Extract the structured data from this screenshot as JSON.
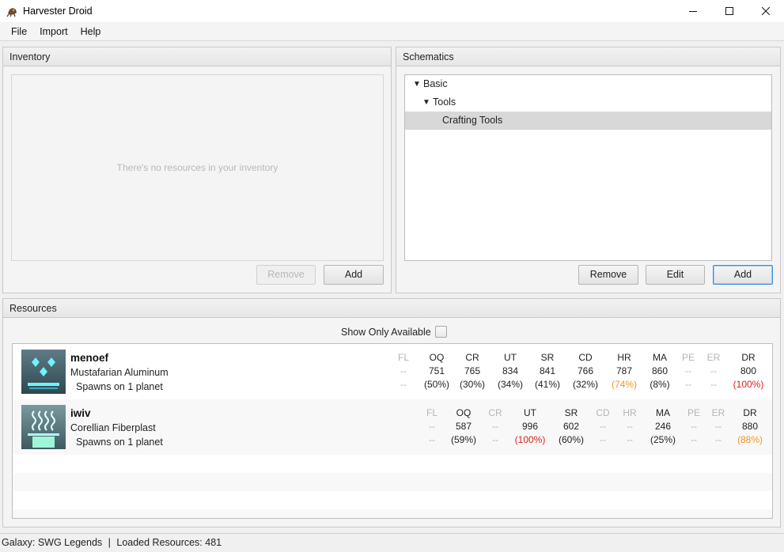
{
  "window": {
    "title": "Harvester Droid"
  },
  "menu": [
    "File",
    "Import",
    "Help"
  ],
  "inventory": {
    "title": "Inventory",
    "placeholder": "There's no resources in your inventory",
    "remove_label": "Remove",
    "add_label": "Add"
  },
  "schematics": {
    "title": "Schematics",
    "tree": [
      {
        "label": "Basic",
        "expanded": true,
        "level": 0
      },
      {
        "label": "Tools",
        "expanded": true,
        "level": 1
      },
      {
        "label": "Crafting Tools",
        "selected": true,
        "level": 2
      }
    ],
    "remove_label": "Remove",
    "edit_label": "Edit",
    "add_label": "Add"
  },
  "resources": {
    "title": "Resources",
    "show_only_available_label": "Show Only Available",
    "items": [
      {
        "name": "menoef",
        "type": "Mustafarian Aluminum",
        "spawns": "Spawns on 1 planet",
        "icon": "aluminum-icon",
        "stats": [
          {
            "h": "FL",
            "v": "--",
            "p": "--",
            "dim": true
          },
          {
            "h": "OQ",
            "v": "751",
            "p": "(50%)"
          },
          {
            "h": "CR",
            "v": "765",
            "p": "(30%)"
          },
          {
            "h": "UT",
            "v": "834",
            "p": "(34%)"
          },
          {
            "h": "SR",
            "v": "841",
            "p": "(41%)"
          },
          {
            "h": "CD",
            "v": "766",
            "p": "(32%)"
          },
          {
            "h": "HR",
            "v": "787",
            "p": "(74%)",
            "color": "orange"
          },
          {
            "h": "MA",
            "v": "860",
            "p": "(8%)"
          },
          {
            "h": "PE",
            "v": "--",
            "p": "--",
            "dim": true
          },
          {
            "h": "ER",
            "v": "--",
            "p": "--",
            "dim": true
          },
          {
            "h": "DR",
            "v": "800",
            "p": "(100%)",
            "color": "red"
          }
        ]
      },
      {
        "name": "iwiv",
        "type": "Corellian Fiberplast",
        "spawns": "Spawns on 1 planet",
        "icon": "fiberplast-icon",
        "stats": [
          {
            "h": "FL",
            "v": "--",
            "p": "--",
            "dim": true
          },
          {
            "h": "OQ",
            "v": "587",
            "p": "(59%)"
          },
          {
            "h": "CR",
            "v": "--",
            "p": "--",
            "dim": true
          },
          {
            "h": "UT",
            "v": "996",
            "p": "(100%)",
            "color": "red"
          },
          {
            "h": "SR",
            "v": "602",
            "p": "(60%)"
          },
          {
            "h": "CD",
            "v": "--",
            "p": "--",
            "dim": true
          },
          {
            "h": "HR",
            "v": "--",
            "p": "--",
            "dim": true
          },
          {
            "h": "MA",
            "v": "246",
            "p": "(25%)"
          },
          {
            "h": "PE",
            "v": "--",
            "p": "--",
            "dim": true
          },
          {
            "h": "ER",
            "v": "--",
            "p": "--",
            "dim": true
          },
          {
            "h": "DR",
            "v": "880",
            "p": "(88%)",
            "color": "orange"
          }
        ]
      }
    ]
  },
  "status": {
    "galaxy": "Galaxy: SWG Legends",
    "separator": "|",
    "loaded": "Loaded Resources: 481"
  },
  "colors": {
    "focus": "#3c8ee0",
    "orange": "#f0961e",
    "red": "#e0201c",
    "dim": "#b5b5b5"
  }
}
